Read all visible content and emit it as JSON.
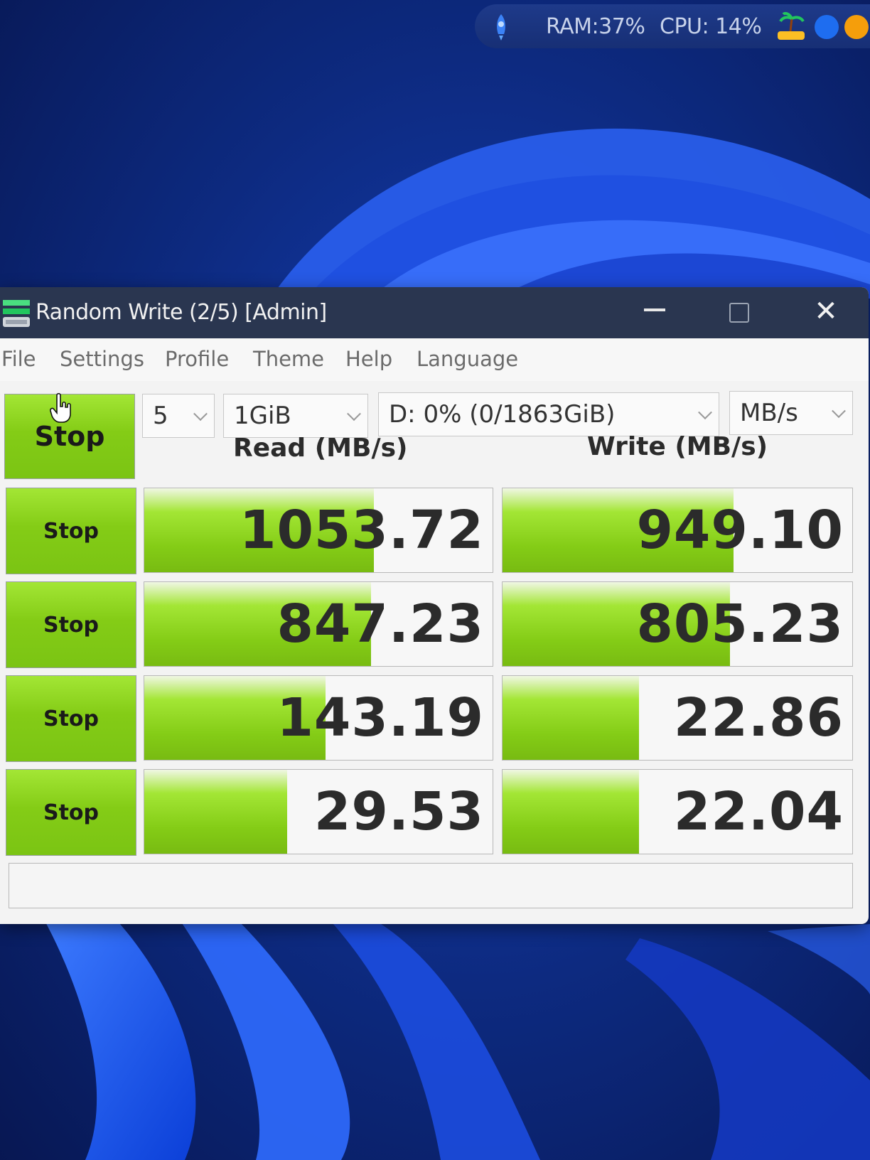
{
  "tray": {
    "ram": "RAM:37%",
    "cpu": "CPU: 14%",
    "icons": [
      "rocket-icon",
      "island-icon",
      "arrow-icon",
      "bell-icon"
    ]
  },
  "window": {
    "title": "Random Write (2/5) [Admin]",
    "menu": [
      "File",
      "Settings",
      "Profile",
      "Theme",
      "Help",
      "Language"
    ],
    "all_button": "Stop",
    "count": "5",
    "size": "1GiB",
    "drive": "D: 0% (0/1863GiB)",
    "unit": "MB/s",
    "read_header": "Read (MB/s)",
    "write_header": "Write (MB/s)",
    "rows": [
      {
        "button": "Stop",
        "read": "1053.72",
        "write": "949.10",
        "read_fill": 0.66,
        "write_fill": 0.66
      },
      {
        "button": "Stop",
        "read": "847.23",
        "write": "805.23",
        "read_fill": 0.65,
        "write_fill": 0.65
      },
      {
        "button": "Stop",
        "read": "143.19",
        "write": "22.86",
        "read_fill": 0.52,
        "write_fill": 0.39
      },
      {
        "button": "Stop",
        "read": "29.53",
        "write": "22.04",
        "read_fill": 0.41,
        "write_fill": 0.39
      }
    ],
    "status": ""
  },
  "colors": {
    "accent_green": "#84cc16",
    "titlebar": "#2a3650",
    "wallpaper": "#0a1f5c"
  }
}
